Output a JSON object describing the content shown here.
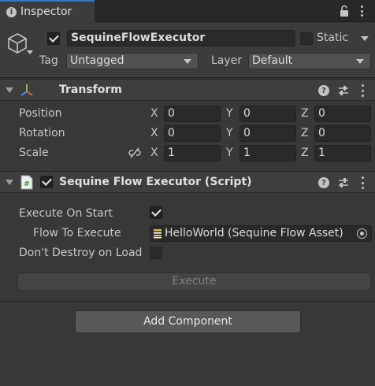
{
  "window": {
    "tab_title": "Inspector",
    "tab_icon": "info-icon"
  },
  "gameobject": {
    "active": true,
    "name": "SequineFlowExecutor",
    "static_label": "Static",
    "static_checked": false,
    "tag_label": "Tag",
    "tag_value": "Untagged",
    "layer_label": "Layer",
    "layer_value": "Default"
  },
  "transform": {
    "title": "Transform",
    "rows": [
      {
        "label": "Position",
        "x": "0",
        "y": "0",
        "z": "0"
      },
      {
        "label": "Rotation",
        "x": "0",
        "y": "0",
        "z": "0"
      },
      {
        "label": "Scale",
        "x": "1",
        "y": "1",
        "z": "1"
      }
    ],
    "axis_labels": {
      "x": "X",
      "y": "Y",
      "z": "Z"
    }
  },
  "script_component": {
    "enabled": true,
    "title": "Sequine Flow Executor (Script)",
    "execute_on_start_label": "Execute On Start",
    "execute_on_start": true,
    "flow_to_execute_label": "Flow To Execute",
    "flow_to_execute_value": "HelloWorld (Sequine Flow Asset)",
    "dont_destroy_label": "Don't Destroy on Load",
    "dont_destroy": false,
    "execute_button": "Execute"
  },
  "add_component_button": "Add Component",
  "colors": {
    "background": "#383838",
    "tab_accent": "#3a79bb",
    "field": "#2a2a2a"
  }
}
